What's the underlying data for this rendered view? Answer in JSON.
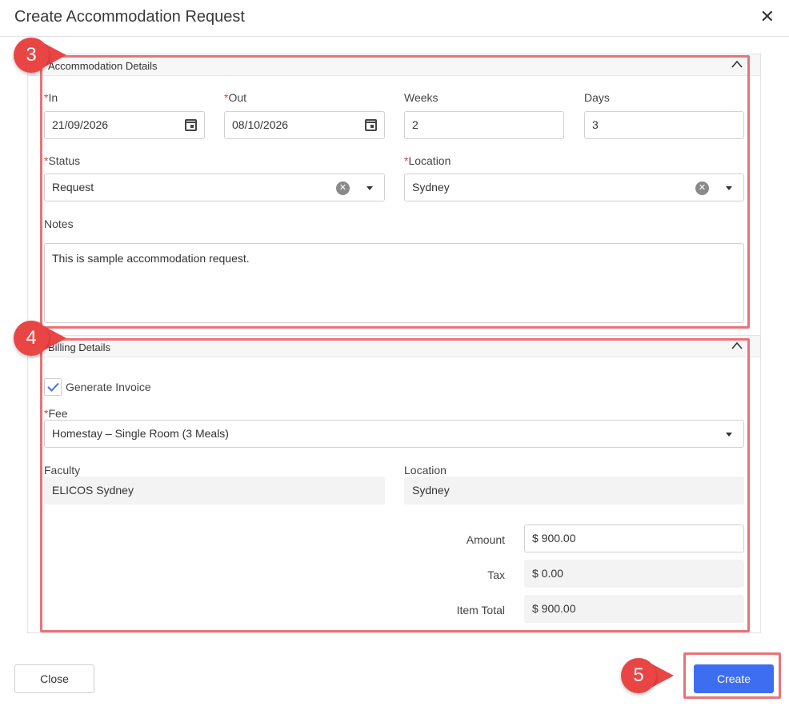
{
  "dialog": {
    "title": "Create Accommodation Request",
    "close_glyph": "✕"
  },
  "accommodation": {
    "section_title": "Accommodation Details",
    "in_label": "In",
    "in_value": "21/09/2026",
    "out_label": "Out",
    "out_value": "08/10/2026",
    "weeks_label": "Weeks",
    "weeks_value": "2",
    "days_label": "Days",
    "days_value": "3",
    "status_label": "Status",
    "status_value": "Request",
    "location_label": "Location",
    "location_value": "Sydney",
    "notes_label": "Notes",
    "notes_value": "This is sample accommodation request."
  },
  "billing": {
    "section_title": "Billing Details",
    "generate_invoice_label": "Generate Invoice",
    "generate_invoice_checked": true,
    "fee_label": "Fee",
    "fee_value": "Homestay – Single Room (3 Meals)",
    "faculty_label": "Faculty",
    "faculty_value": "ELICOS Sydney",
    "location_label": "Location",
    "location_value": "Sydney",
    "amount_label": "Amount",
    "amount_value": "$ 900.00",
    "tax_label": "Tax",
    "tax_value": "$ 0.00",
    "item_total_label": "Item Total",
    "item_total_value": "$ 900.00"
  },
  "footer": {
    "close_label": "Close",
    "create_label": "Create"
  },
  "annotations": {
    "step_3": "3",
    "step_4": "4",
    "step_5": "5"
  },
  "colors": {
    "primary": "#3d6ef2",
    "highlight": "#e8737a",
    "badge": "#ea4545",
    "required": "#e0463f"
  }
}
